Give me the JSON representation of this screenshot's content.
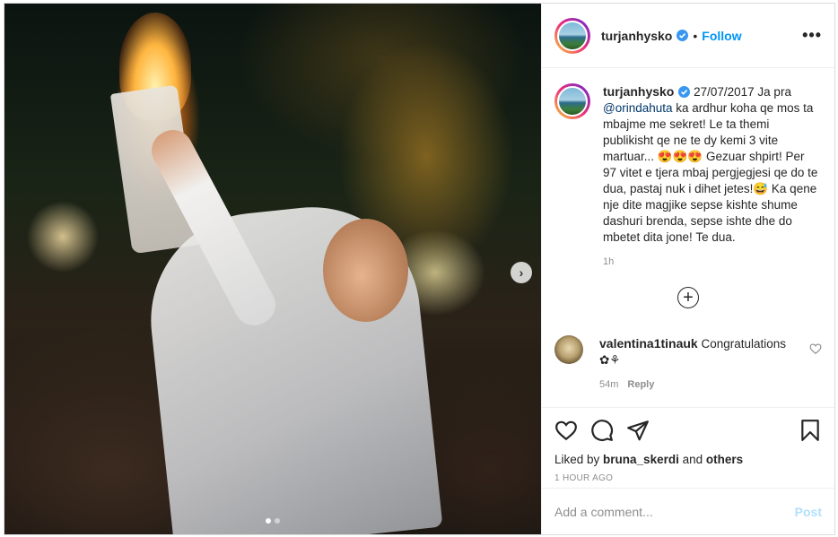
{
  "post": {
    "author": "turjanhysko",
    "follow_label": "Follow",
    "separator": "•",
    "more_label": "•••"
  },
  "caption": {
    "username": "turjanhysko",
    "text_lead": " 27/07/2017 Ja pra ",
    "mention": "@orindahuta",
    "text_body": " ka ardhur koha qe mos ta mbajme me sekret! Le ta themi publikisht qe ne te dy kemi 3 vite martuar... 😍😍😍 Gezuar shpirt! Per 97 vitet e tjera mbaj pergjegjesi qe do te dua, pastaj nuk i dihet jetes!😅 Ka qene nje dite magjike sepse kishte shume dashuri brenda, sepse ishte dhe do mbetet dita jone! Te dua.",
    "age": "1h"
  },
  "load_more_label": "+",
  "comment": {
    "username": "valentina1tinauk",
    "text": " Congratulations ✿⚘",
    "age": "54m",
    "reply_label": "Reply"
  },
  "actions": {
    "icons": [
      "heart-icon",
      "comment-icon",
      "share-icon",
      "bookmark-icon"
    ],
    "liked_by_prefix": "Liked by ",
    "liked_by_user": "bruna_skerdi",
    "liked_by_and": " and ",
    "liked_by_others": "others",
    "timestamp": "1 HOUR AGO"
  },
  "add_comment": {
    "placeholder": "Add a comment...",
    "post_label": "Post"
  },
  "carousel": {
    "next_label": "›",
    "slide_count": 2,
    "active_slide": 1
  },
  "colors": {
    "link_blue": "#0095f6",
    "mention_blue": "#00376b",
    "muted_gray": "#8e8e8e",
    "post_disabled": "#b2dffc"
  }
}
